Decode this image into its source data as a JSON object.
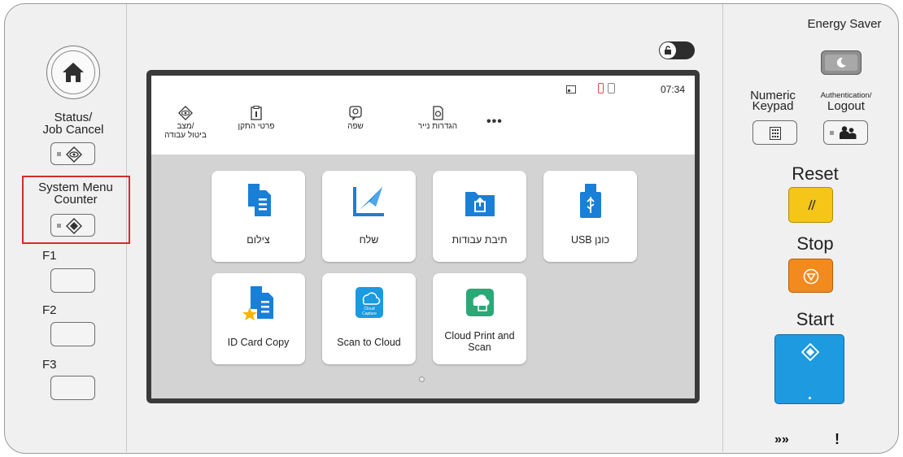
{
  "left_panel": {
    "status_label_1": "Status/",
    "status_label_2": "Job Cancel",
    "system_menu_label_1": "System Menu",
    "system_menu_label_2": "Counter",
    "f1_label": "F1",
    "f2_label": "F2",
    "f3_label": "F3"
  },
  "screen": {
    "time": "07:34",
    "top_items": [
      {
        "label_1": "מצב/",
        "label_2": "ביטול עבודה",
        "icon": "eye-diamond-icon"
      },
      {
        "label": "פרטי התקן",
        "icon": "device-info-icon"
      },
      {
        "label": "שפה",
        "icon": "language-icon"
      },
      {
        "label": "הגדרות נייר",
        "icon": "paper-settings-icon"
      },
      {
        "label": "•••",
        "icon": "more-icon"
      }
    ],
    "tiles": [
      {
        "label": "צילום",
        "icon": "copy-icon"
      },
      {
        "label": "שלח",
        "icon": "send-icon"
      },
      {
        "label": "תיבת עבודות",
        "icon": "job-box-icon"
      },
      {
        "label": "USB כונן",
        "icon": "usb-icon"
      },
      {
        "label": "ID Card Copy",
        "icon": "id-card-copy-icon"
      },
      {
        "label": "Scan to Cloud",
        "icon": "cloud-capture-icon",
        "icon_text_1": "Cloud",
        "icon_text_2": "Capture"
      },
      {
        "label_1": "Cloud Print and",
        "label_2": "Scan",
        "icon": "cloud-print-icon"
      }
    ]
  },
  "right_panel": {
    "energy_saver_label": "Energy Saver",
    "numeric_keypad_label_1": "Numeric",
    "numeric_keypad_label_2": "Keypad",
    "auth_label_1": "Authentication/",
    "auth_label_2": "Logout",
    "reset_label": "Reset",
    "stop_label": "Stop",
    "start_label": "Start",
    "processing_indicator": "»»",
    "attention_indicator": "!"
  },
  "colors": {
    "reset": "#f5c518",
    "stop": "#f28a1e",
    "start": "#1e9ae0",
    "highlight": "#d62b2b"
  }
}
